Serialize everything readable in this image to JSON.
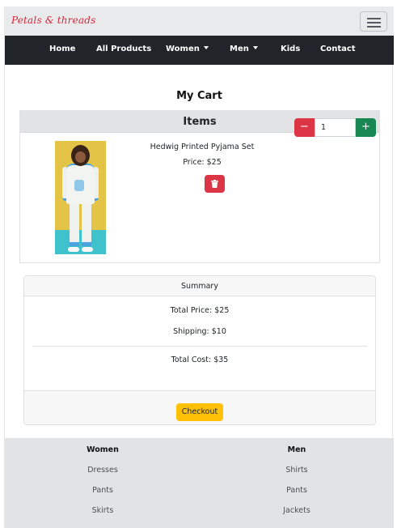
{
  "brand": {
    "name": "Petals & threads",
    "color": "#d6263a"
  },
  "navbar": {
    "items": [
      {
        "label": "Home"
      },
      {
        "label": "All Products"
      },
      {
        "label": "Women"
      },
      {
        "label": "Men"
      },
      {
        "label": "Kids"
      },
      {
        "label": "Contact"
      }
    ]
  },
  "page": {
    "title": "My Cart"
  },
  "items_card": {
    "header": "Items",
    "product": {
      "name": "Hedwig Printed Pyjama Set",
      "price": "Price: $25",
      "quantity": "1",
      "image_icon": "product-photo"
    },
    "minus_label": "−",
    "plus_label": "+",
    "colors": {
      "minus": "#dc3545",
      "plus": "#198754",
      "delete": "#dc3545"
    }
  },
  "summary": {
    "header": "Summary",
    "total_price": "Total Price: $25",
    "shipping": "Shipping: $10",
    "total_cost": "Total Cost: $35",
    "checkout_label": "Checkout",
    "checkout_color": "#ffc107"
  },
  "footer": {
    "columns": [
      {
        "heading": "Women",
        "links": [
          "Dresses",
          "Pants",
          "Skirts"
        ]
      },
      {
        "heading": "Men",
        "links": [
          "Shirts",
          "Pants",
          "Jackets"
        ]
      }
    ]
  }
}
